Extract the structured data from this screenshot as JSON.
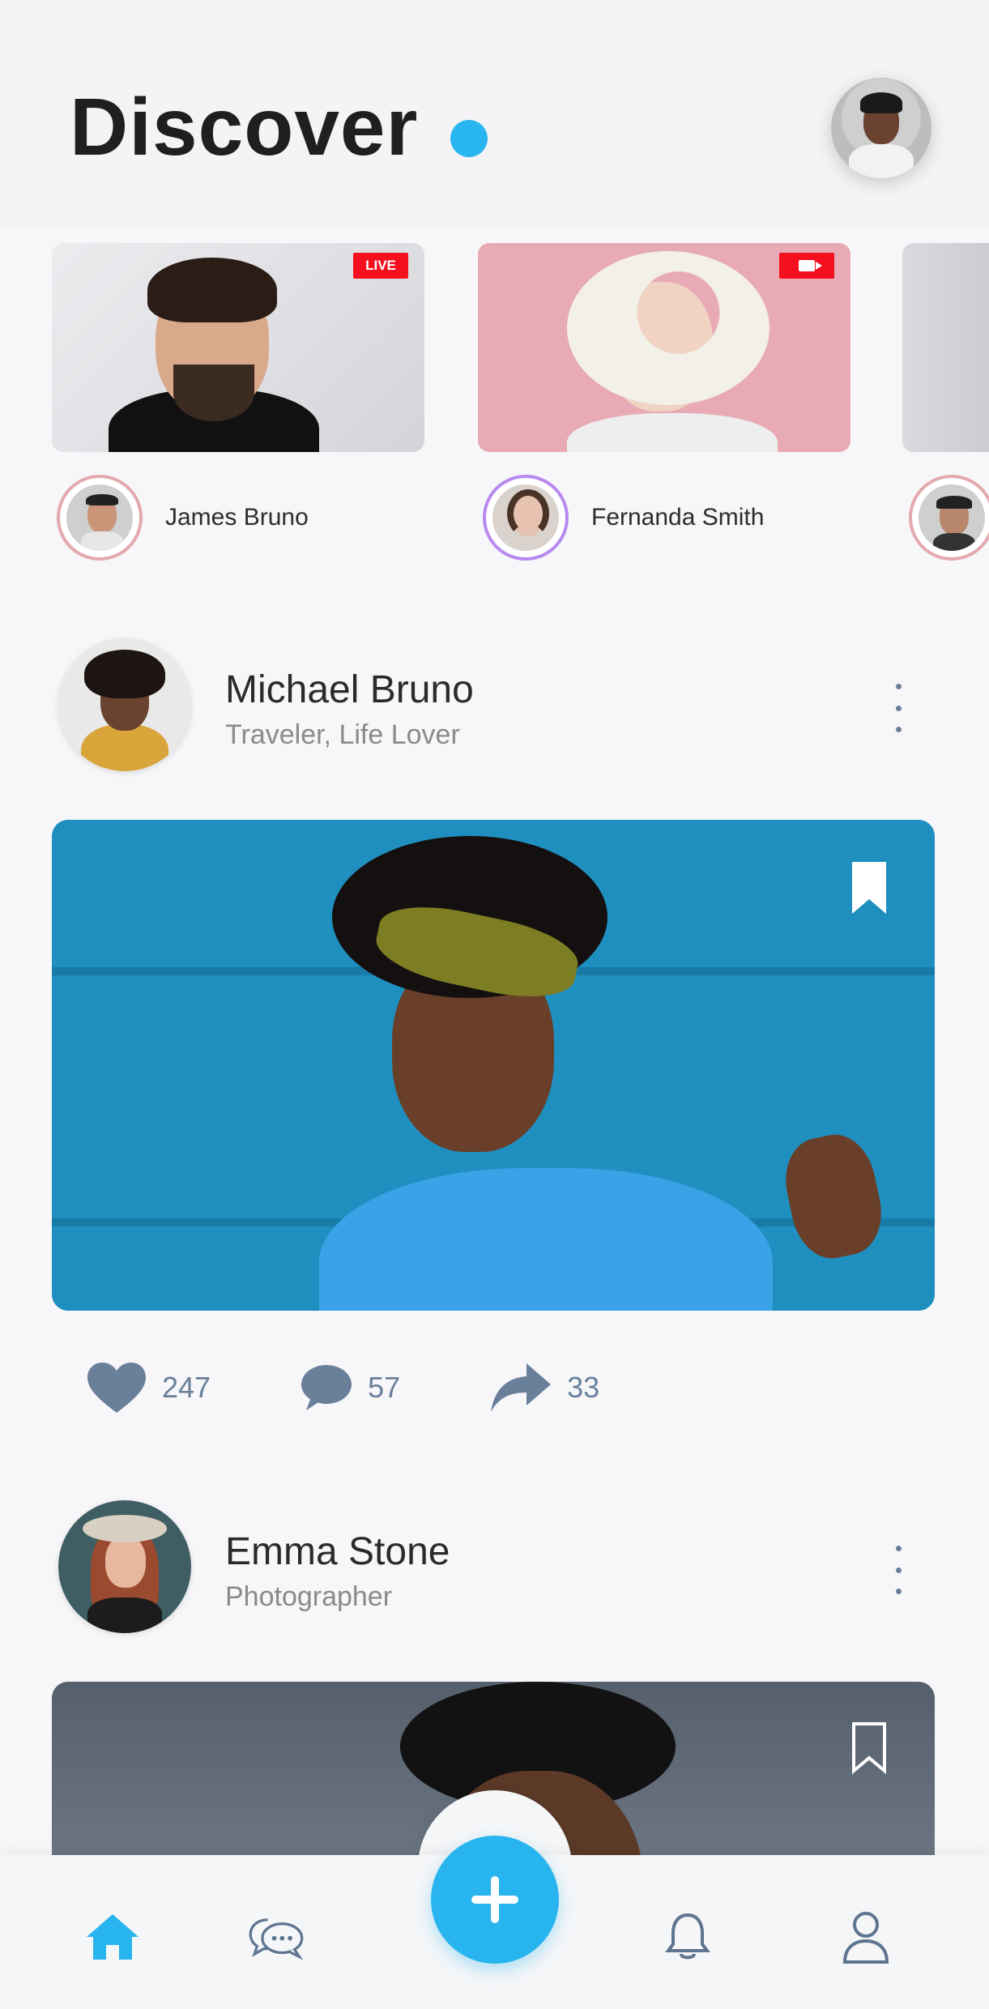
{
  "header": {
    "title": "Discover"
  },
  "stories": [
    {
      "name": "James Bruno",
      "badge": "LIVE",
      "badge_type": "live"
    },
    {
      "name": "Fernanda Smith",
      "badge_type": "video"
    },
    {
      "name": ""
    }
  ],
  "posts": [
    {
      "author": "Michael Bruno",
      "subtitle": "Traveler, Life Lover",
      "likes": "247",
      "comments": "57",
      "shares": "33"
    },
    {
      "author": "Emma Stone",
      "subtitle": "Photographer"
    }
  ],
  "nav": {
    "items": [
      "home-icon",
      "chat-icon",
      "add-icon",
      "bell-icon",
      "profile-icon"
    ],
    "active": "home-icon"
  },
  "colors": {
    "accent": "#28b4ee",
    "icon_muted": "#6a7f9a",
    "live_badge": "#f5101d"
  }
}
